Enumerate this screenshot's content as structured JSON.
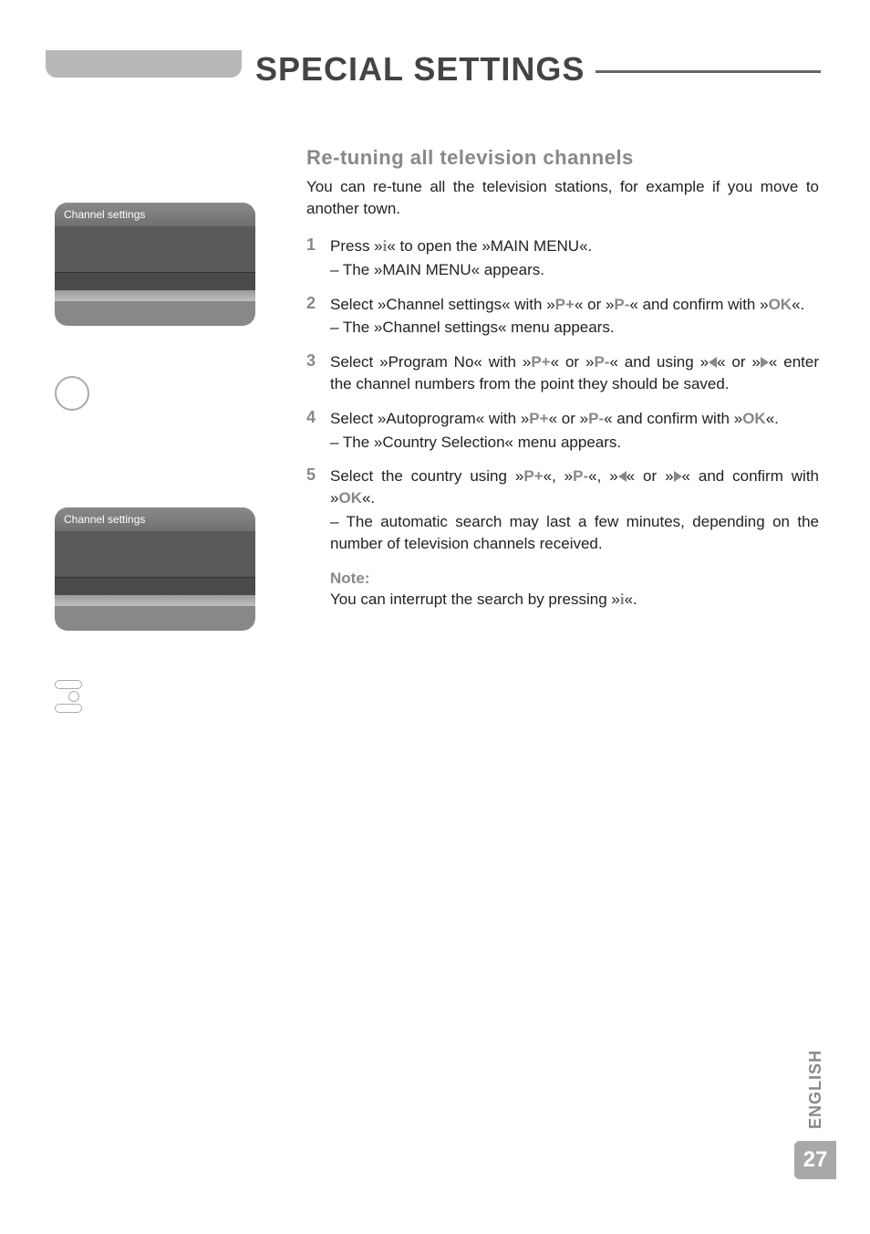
{
  "title": "SPECIAL SETTINGS",
  "section_heading": "Re-tuning all television channels",
  "intro": "You can re-tune all the television stations, for example if you move to another town.",
  "sidebar": {
    "menu1_title": "Channel settings",
    "menu2_title": "Channel settings"
  },
  "steps": [
    {
      "num": "1",
      "parts": [
        "Press »",
        {
          "key": "i",
          "cls": "info-i"
        },
        "« to open the »MAIN MENU«."
      ],
      "sub": "– The »MAIN MENU« appears."
    },
    {
      "num": "2",
      "parts": [
        "Select »Channel settings« with »",
        {
          "key": "P+",
          "cls": "bold-key"
        },
        "« or »",
        {
          "key": "P-",
          "cls": "bold-key"
        },
        "« and confirm with »",
        {
          "key": "OK",
          "cls": "bold-key"
        },
        "«."
      ],
      "sub": "– The »Channel settings« menu appears."
    },
    {
      "num": "3",
      "parts": [
        "Select »Program No« with »",
        {
          "key": "P+",
          "cls": "bold-key"
        },
        "« or »",
        {
          "key": "P-",
          "cls": "bold-key"
        },
        "« and using »",
        {
          "tri": "left"
        },
        "« or »",
        {
          "tri": "right"
        },
        "« enter the channel numbers from the point they should be saved."
      ]
    },
    {
      "num": "4",
      "parts": [
        "Select »Autoprogram« with »",
        {
          "key": "P+",
          "cls": "bold-key"
        },
        "« or »",
        {
          "key": "P-",
          "cls": "bold-key"
        },
        "« and confirm with »",
        {
          "key": "OK",
          "cls": "bold-key"
        },
        "«."
      ],
      "sub": "– The »Country Selection« menu appears."
    },
    {
      "num": "5",
      "parts": [
        "Select the country using »",
        {
          "key": "P+",
          "cls": "bold-key"
        },
        "«, »",
        {
          "key": "P-",
          "cls": "bold-key"
        },
        "«, »",
        {
          "tri": "left"
        },
        "« or »",
        {
          "tri": "right"
        },
        "« and confirm with »",
        {
          "key": "OK",
          "cls": "bold-key"
        },
        "«."
      ],
      "sub": "– The automatic search may last a few minutes, depending on the number of television channels received."
    }
  ],
  "note": {
    "label": "Note:",
    "body_parts": [
      "You can interrupt the search by pressing »",
      {
        "key": "i",
        "cls": "info-i"
      },
      "«."
    ]
  },
  "lang_tab": "ENGLISH",
  "page_number": "27"
}
